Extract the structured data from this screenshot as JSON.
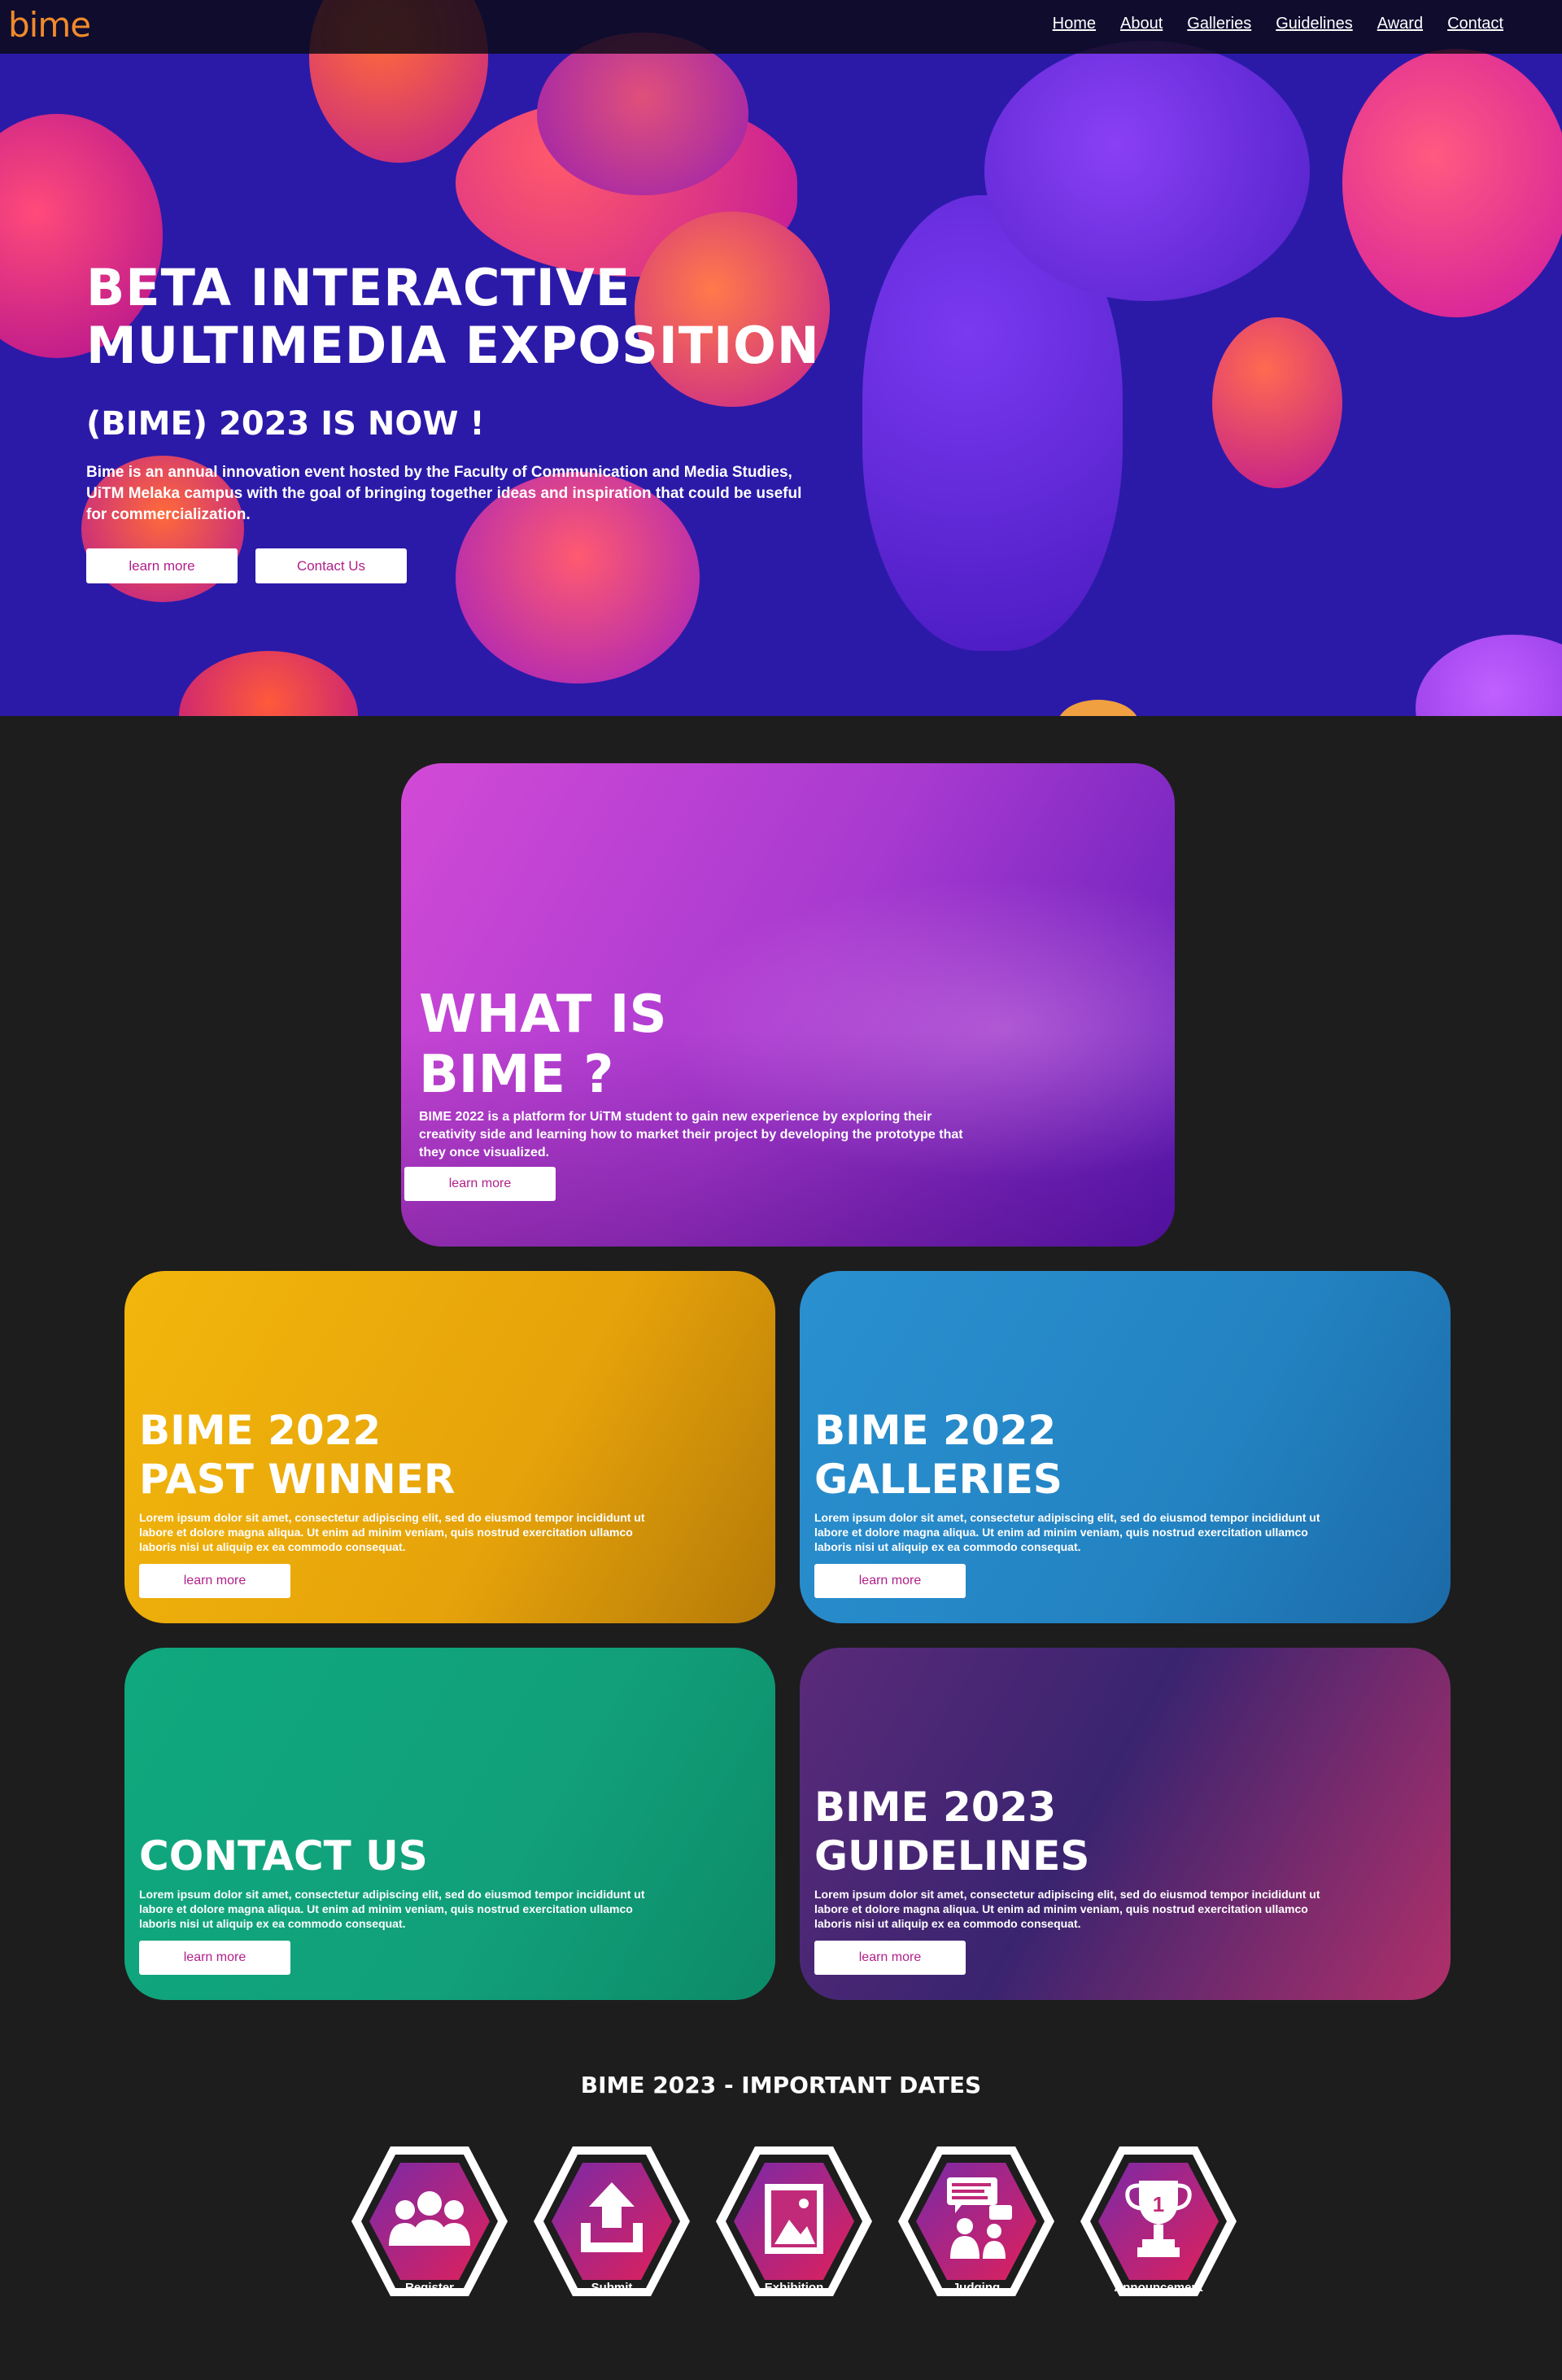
{
  "header": {
    "logo": "bime",
    "nav": [
      "Home",
      "About",
      "Galleries",
      "Guidelines",
      "Award",
      "Contact"
    ]
  },
  "hero": {
    "title_line1": "BETA INTERACTIVE",
    "title_line2": "MULTIMEDIA EXPOSITION",
    "subtitle": "(BIME) 2023 IS NOW !",
    "description": "Bime is an annual innovation event hosted by the Faculty of Communication and Media Studies, UiTM Melaka campus with the goal of bringing together ideas and inspiration that could be useful for commercialization.",
    "btn_learn": "learn more",
    "btn_contact": "Contact Us"
  },
  "cards": [
    {
      "title1": "WHAT IS",
      "title2": "BIME ?",
      "desc": "BIME 2022 is a platform for UiTM student to gain new experience by exploring their creativity side and learning how to market their project by developing the prototype that they once visualized.",
      "btn": "learn more"
    },
    {
      "title1": "BIME 2022",
      "title2": "PAST WINNER",
      "desc": "Lorem ipsum dolor sit amet, consectetur adipiscing elit, sed do eiusmod tempor incididunt ut labore et dolore magna aliqua. Ut enim ad minim veniam, quis nostrud exercitation ullamco laboris nisi ut aliquip ex ea commodo consequat.",
      "btn": "learn more"
    },
    {
      "title1": "BIME 2022",
      "title2": "GALLERIES",
      "desc": "Lorem ipsum dolor sit amet, consectetur adipiscing elit, sed do eiusmod tempor incididunt ut labore et dolore magna aliqua. Ut enim ad minim veniam, quis nostrud exercitation ullamco laboris nisi ut aliquip ex ea commodo consequat.",
      "btn": "learn more"
    },
    {
      "title1": "CONTACT US",
      "title2": "",
      "desc": "Lorem ipsum dolor sit amet, consectetur adipiscing elit, sed do eiusmod tempor incididunt ut labore et dolore magna aliqua. Ut enim ad minim veniam, quis nostrud exercitation ullamco laboris nisi ut aliquip ex ea commodo consequat.",
      "btn": "learn more"
    },
    {
      "title1": "BIME 2023",
      "title2": "GUIDELINES",
      "desc": "Lorem ipsum dolor sit amet, consectetur adipiscing elit, sed do eiusmod tempor incididunt ut labore et dolore magna aliqua. Ut enim ad minim veniam, quis nostrud exercitation ullamco laboris nisi ut aliquip ex ea commodo consequat.",
      "btn": "learn more"
    }
  ],
  "dates": {
    "title": "BIME 2023 - IMPORTANT DATES",
    "items": [
      {
        "label": "Register",
        "icon": "people-icon"
      },
      {
        "label": "Submit",
        "icon": "upload-icon"
      },
      {
        "label": "Exhibition",
        "icon": "picture-icon"
      },
      {
        "label": "Judging",
        "icon": "judging-icon"
      },
      {
        "label": "Announcement",
        "icon": "trophy-icon"
      }
    ],
    "trophy_number": "1"
  },
  "colors": {
    "accent": "#b0208a",
    "logo": "#f08a2a",
    "bg": "#1d1d1d",
    "hero_bg": "#2b1aa8",
    "card_what": "#a23bcf",
    "card_winner": "#e6a80a",
    "card_galleries": "#2383c2",
    "card_contact": "#11a07a",
    "card_guidelines": "#3a2470"
  }
}
